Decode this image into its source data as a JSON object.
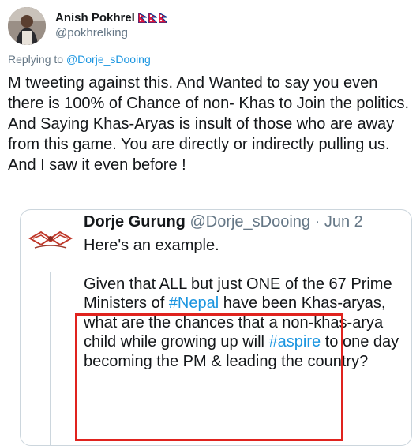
{
  "author": {
    "display_name": "Anish Pokhrel",
    "handle": "@pokhrelking",
    "flags": [
      "nepal-flag-icon",
      "nepal-flag-icon",
      "nepal-flag-icon"
    ]
  },
  "replying": {
    "prefix": "Replying to",
    "handle": "@Dorje_sDooing"
  },
  "tweet": {
    "text": "M tweeting against this. And Wanted to say you even there is 100% of Chance of non- Khas to Join the politics.\nAnd Saying Khas-Aryas is insult of those who are away from this game. You are directly or indirectly pulling us. And I saw it even before !"
  },
  "quote": {
    "display_name": "Dorje Gurung",
    "handle": "@Dorje_sDooing",
    "separator": "·",
    "date": "Jun 2",
    "line1": "Here's an example.",
    "body_a": "Given that ALL but just ONE of the 67 Prime Ministers of ",
    "hashtag1": "#Nepal",
    "body_b": " have been Khas-aryas, what are the chances that a non-khas-arya child while growing up will ",
    "hashtag2": "#aspire",
    "body_c": " to one day becoming the PM & leading the country?"
  },
  "colors": {
    "link": "#1b95e0",
    "secondary": "#657786",
    "highlight": "#e0231e"
  }
}
